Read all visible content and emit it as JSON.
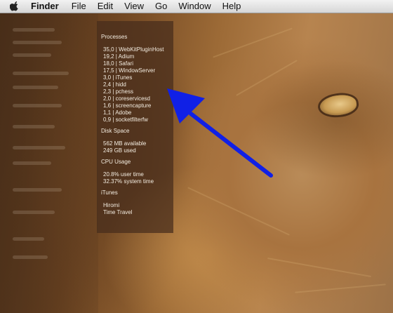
{
  "menubar": {
    "app_name": "Finder",
    "items": [
      "File",
      "Edit",
      "View",
      "Go",
      "Window",
      "Help"
    ]
  },
  "panel": {
    "processes_title": "Processes",
    "processes": [
      "35,0 | WebKitPluginHost",
      "19,2 | Adium",
      "18,0 | Safari",
      "17,5 | WindowServer",
      "3,0 | iTunes",
      "2,4 | hidd",
      "2,3 | pchess",
      "2,0 | coreservicesd",
      "1,6 | screencapture",
      "1,1 | Adobe",
      "0,9 | socketfilterfw"
    ],
    "disk_title": "Disk Space",
    "disk_available": "562 MB available",
    "disk_used": "249 GB used",
    "cpu_title": "CPU Usage",
    "cpu_user": "20.8% user time",
    "cpu_system": "32.37% system time",
    "itunes_title": "iTunes",
    "itunes_artist": "Hiromi",
    "itunes_track": "Time Travel"
  },
  "icons": {
    "apple": "apple-logo",
    "arrow": "blue-arrow"
  },
  "colors": {
    "arrow": "#1020e6",
    "panel_text": "#f3ece0"
  }
}
